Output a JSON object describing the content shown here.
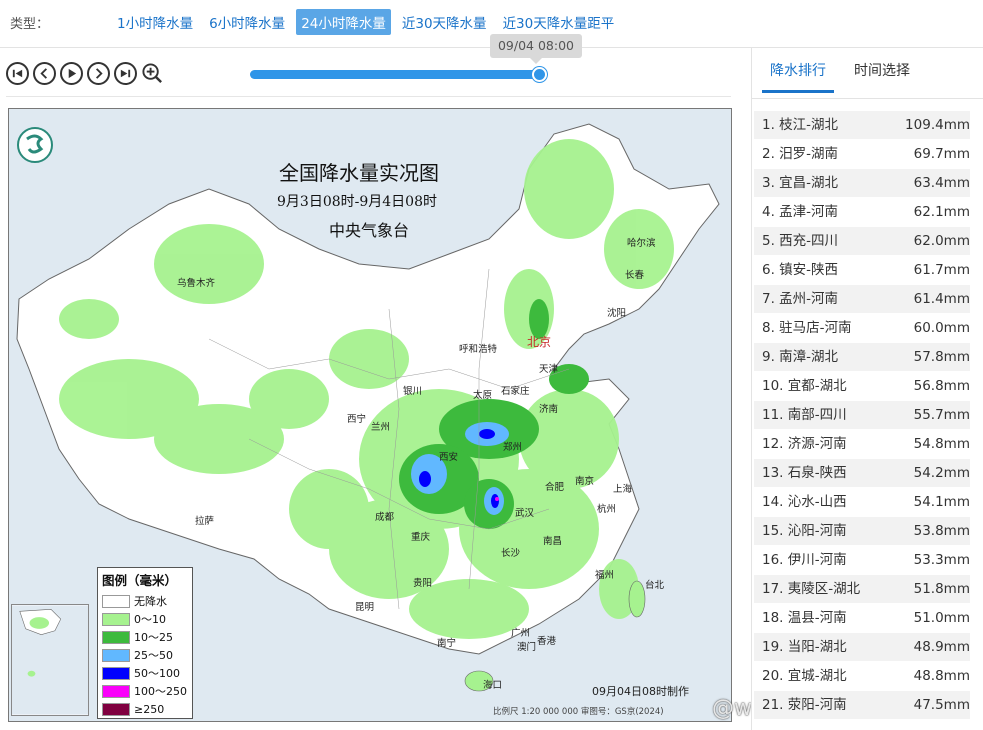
{
  "header": {
    "type_label": "类型：",
    "tabs": [
      {
        "label": "1小时降水量",
        "active": false
      },
      {
        "label": "6小时降水量",
        "active": false
      },
      {
        "label": "24小时降水量",
        "active": true
      },
      {
        "label": "近30天降水量",
        "active": false
      },
      {
        "label": "近30天降水量距平",
        "active": false
      }
    ]
  },
  "player": {
    "controls": [
      "first-icon",
      "prev-icon",
      "play-icon",
      "next-icon",
      "last-icon",
      "zoom-in-icon"
    ],
    "time_tip": "09/04 08:00",
    "progress": 1.0
  },
  "map": {
    "title": "全国降水量实况图",
    "subtitle": "9月3日08时-9月4日08时",
    "agency": "中央气象台",
    "cities": [
      "乌鲁木齐",
      "哈尔滨",
      "长春",
      "沈阳",
      "呼和浩特",
      "北京",
      "天津",
      "银川",
      "太原",
      "石家庄",
      "济南",
      "西宁",
      "兰州",
      "郑州",
      "西安",
      "合肥",
      "南京",
      "上海",
      "拉萨",
      "成都",
      "武汉",
      "杭州",
      "重庆",
      "长沙",
      "南昌",
      "福州",
      "贵阳",
      "昆明",
      "台北",
      "南宁",
      "广州",
      "香港",
      "澳门",
      "海口"
    ],
    "legend": {
      "title": "图例（毫米）",
      "items": [
        {
          "label": "无降水",
          "color": "#ffffff"
        },
        {
          "label": "0～10",
          "color": "#a6f28f"
        },
        {
          "label": "10～25",
          "color": "#3dba3d"
        },
        {
          "label": "25～50",
          "color": "#61b8ff"
        },
        {
          "label": "50～100",
          "color": "#0000fe"
        },
        {
          "label": "100～250",
          "color": "#fa00fa"
        },
        {
          "label": "≥250",
          "color": "#800040"
        }
      ]
    },
    "made_time": "09月04日08时制作",
    "footer": "比例尺 1:20 000 000    审图号：GS京(2024)"
  },
  "watermark": "@weatherman_信欣",
  "panel": {
    "tabs": [
      {
        "label": "降水排行",
        "active": true
      },
      {
        "label": "时间选择",
        "active": false
      }
    ],
    "ranking": [
      {
        "name": "1. 枝江-湖北",
        "value": "109.4mm"
      },
      {
        "name": "2. 汨罗-湖南",
        "value": "69.7mm"
      },
      {
        "name": "3. 宜昌-湖北",
        "value": "63.4mm"
      },
      {
        "name": "4. 孟津-河南",
        "value": "62.1mm"
      },
      {
        "name": "5. 西充-四川",
        "value": "62.0mm"
      },
      {
        "name": "6. 镇安-陕西",
        "value": "61.7mm"
      },
      {
        "name": "7. 孟州-河南",
        "value": "61.4mm"
      },
      {
        "name": "8. 驻马店-河南",
        "value": "60.0mm"
      },
      {
        "name": "9. 南漳-湖北",
        "value": "57.8mm"
      },
      {
        "name": "10. 宜都-湖北",
        "value": "56.8mm"
      },
      {
        "name": "11. 南部-四川",
        "value": "55.7mm"
      },
      {
        "name": "12. 济源-河南",
        "value": "54.8mm"
      },
      {
        "name": "13. 石泉-陕西",
        "value": "54.2mm"
      },
      {
        "name": "14. 沁水-山西",
        "value": "54.1mm"
      },
      {
        "name": "15. 沁阳-河南",
        "value": "53.8mm"
      },
      {
        "name": "16. 伊川-河南",
        "value": "53.3mm"
      },
      {
        "name": "17. 夷陵区-湖北",
        "value": "51.8mm"
      },
      {
        "name": "18. 温县-河南",
        "value": "51.0mm"
      },
      {
        "name": "19. 当阳-湖北",
        "value": "48.9mm"
      },
      {
        "name": "20. 宜城-湖北",
        "value": "48.8mm"
      },
      {
        "name": "21. 荥阳-河南",
        "value": "47.5mm"
      }
    ]
  }
}
